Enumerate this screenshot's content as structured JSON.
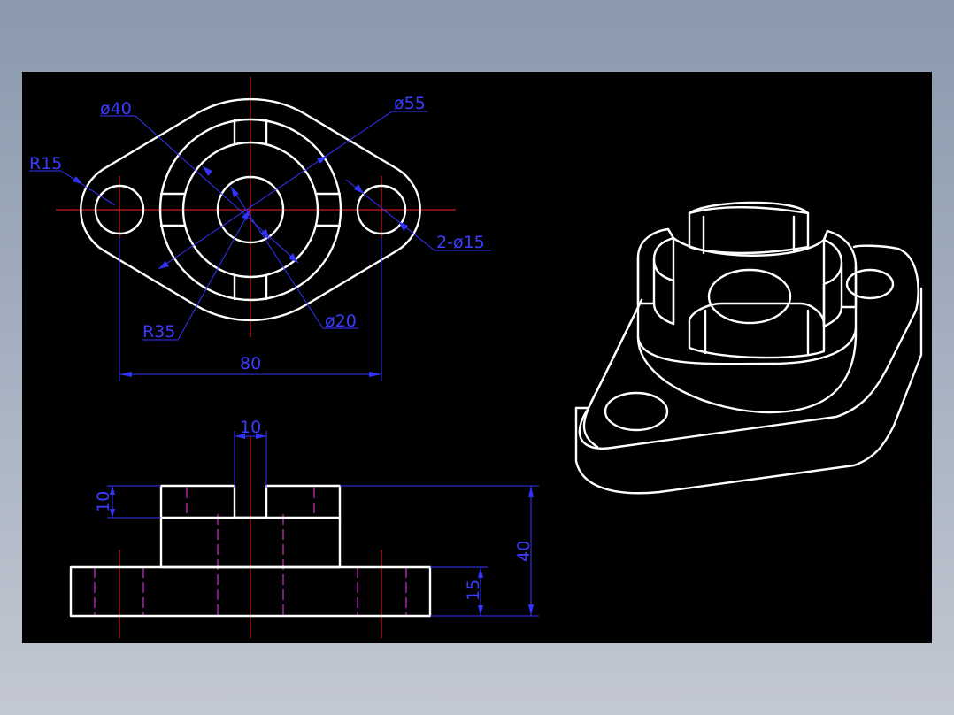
{
  "colors": {
    "background": "#000000",
    "outline": "#ffffff",
    "center_line": "#ff2020",
    "hidden_line": "#ff33ff",
    "dimension": "#3b3bff"
  },
  "top_view": {
    "labels": {
      "phi40": "ø40",
      "phi55": "ø55",
      "r15": "R15",
      "two_phi15": "2-ø15",
      "r35": "R35",
      "phi20": "ø20",
      "width80": "80"
    }
  },
  "front_view": {
    "labels": {
      "slot10": "10",
      "height10": "10",
      "height40": "40",
      "height15": "15"
    }
  }
}
